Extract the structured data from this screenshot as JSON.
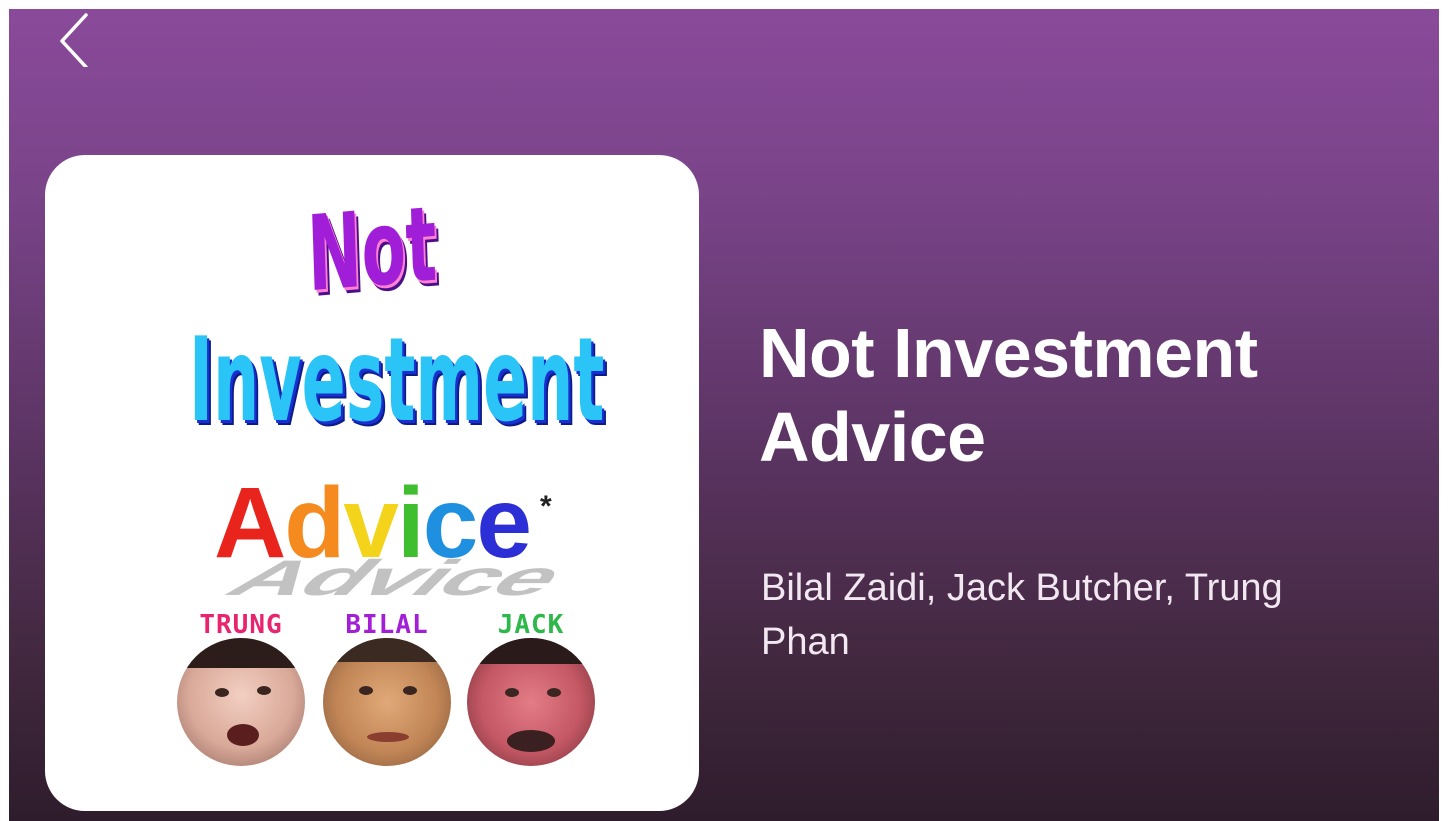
{
  "header": {
    "back_icon": "chevron-left-icon"
  },
  "artwork": {
    "line1": "Not",
    "line2": "Investment",
    "line3": "Advice",
    "asterisk": "*",
    "hosts": [
      {
        "label": "TRUNG",
        "color": "#e8246e"
      },
      {
        "label": "BILAL",
        "color": "#a31fd6"
      },
      {
        "label": "JACK",
        "color": "#2fb84a"
      }
    ]
  },
  "podcast": {
    "title": "Not Investment Advice",
    "authors": "Bilal Zaidi, Jack Butcher, Trung Phan"
  },
  "colors": {
    "background_top": "#8a4a9a",
    "background_bottom": "#2e1c2c",
    "title_text": "#ffffff"
  }
}
